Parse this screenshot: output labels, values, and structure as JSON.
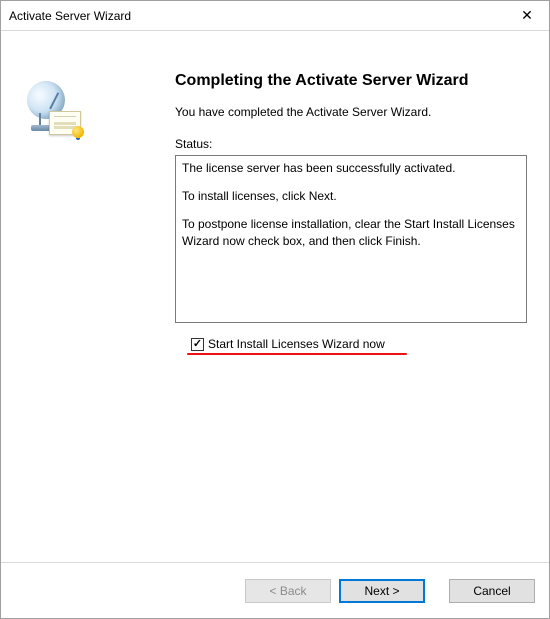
{
  "window": {
    "title": "Activate Server Wizard",
    "close_icon": "✕"
  },
  "heading": "Completing the Activate Server Wizard",
  "intro": "You have completed the Activate Server Wizard.",
  "status": {
    "label": "Status:",
    "lines": {
      "0": "The license server has been successfully activated.",
      "1": "To install licenses, click Next.",
      "2": "To postpone license installation, clear the Start Install Licenses Wizard now check box, and then click Finish."
    }
  },
  "checkbox": {
    "checked_glyph": "✓",
    "label": "Start Install Licenses Wizard now"
  },
  "buttons": {
    "back": "< Back",
    "next": "Next >",
    "cancel": "Cancel"
  }
}
